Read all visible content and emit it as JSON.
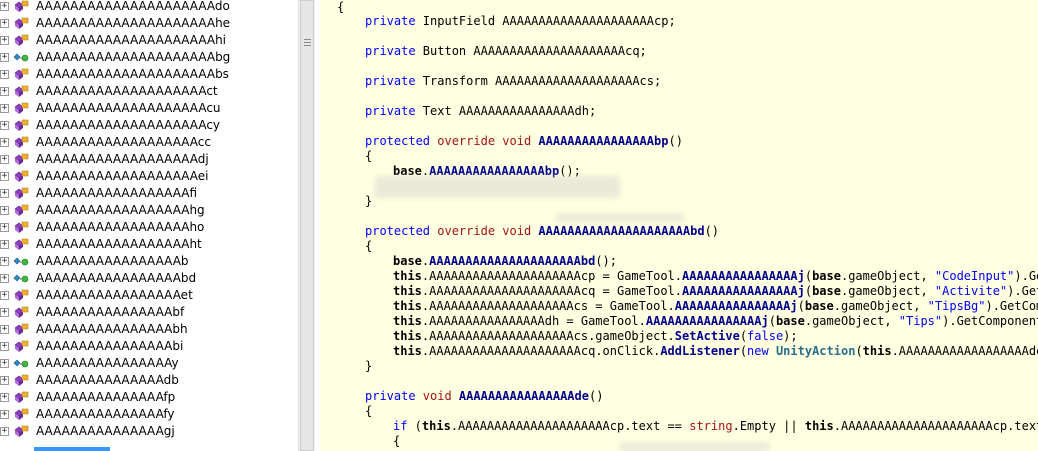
{
  "tree": {
    "items": [
      {
        "label": "AAAAAAAAAAAAAAAAAAAAAdo",
        "icon": "method-icon"
      },
      {
        "label": "AAAAAAAAAAAAAAAAAAAAAhe",
        "icon": "method-icon"
      },
      {
        "label": "AAAAAAAAAAAAAAAAAAAAAhi",
        "icon": "method-icon"
      },
      {
        "label": "AAAAAAAAAAAAAAAAAAAAAbg",
        "icon": "field-icon"
      },
      {
        "label": "AAAAAAAAAAAAAAAAAAAAAbs",
        "icon": "method-icon"
      },
      {
        "label": "AAAAAAAAAAAAAAAAAAAAct",
        "icon": "method-icon"
      },
      {
        "label": "AAAAAAAAAAAAAAAAAAAAcu",
        "icon": "method-icon"
      },
      {
        "label": "AAAAAAAAAAAAAAAAAAAAcy",
        "icon": "method-icon"
      },
      {
        "label": "AAAAAAAAAAAAAAAAAAAcc",
        "icon": "method-icon"
      },
      {
        "label": "AAAAAAAAAAAAAAAAAAAdj",
        "icon": "method-icon"
      },
      {
        "label": "AAAAAAAAAAAAAAAAAAAei",
        "icon": "method-icon"
      },
      {
        "label": "AAAAAAAAAAAAAAAAAAfi",
        "icon": "method-icon"
      },
      {
        "label": "AAAAAAAAAAAAAAAAAAhg",
        "icon": "method-icon"
      },
      {
        "label": "AAAAAAAAAAAAAAAAAAho",
        "icon": "method-icon"
      },
      {
        "label": "AAAAAAAAAAAAAAAAAAht",
        "icon": "method-icon"
      },
      {
        "label": "AAAAAAAAAAAAAAAAAb",
        "icon": "field-icon"
      },
      {
        "label": "AAAAAAAAAAAAAAAAAbd",
        "icon": "field-icon"
      },
      {
        "label": "AAAAAAAAAAAAAAAAAet",
        "icon": "method-icon"
      },
      {
        "label": "AAAAAAAAAAAAAAAAbf",
        "icon": "method-icon"
      },
      {
        "label": "AAAAAAAAAAAAAAAAbh",
        "icon": "method-icon"
      },
      {
        "label": "AAAAAAAAAAAAAAAAbi",
        "icon": "method-icon"
      },
      {
        "label": "AAAAAAAAAAAAAAAAy",
        "icon": "field-icon"
      },
      {
        "label": "AAAAAAAAAAAAAAAdb",
        "icon": "method-icon"
      },
      {
        "label": "AAAAAAAAAAAAAAAfp",
        "icon": "method-icon"
      },
      {
        "label": "AAAAAAAAAAAAAAAfy",
        "icon": "method-icon"
      },
      {
        "label": "AAAAAAAAAAAAAAAgj",
        "icon": "method-icon"
      }
    ],
    "expander_glyph": "+"
  },
  "colors": {
    "code_background": "#ffffe1",
    "keyword": "#0000ff",
    "modifier": "#a31515",
    "method": "#00008b",
    "selection": "#3399ff"
  },
  "code": {
    "l01": "{",
    "l02_kw": "private",
    "l02_rest": " InputField AAAAAAAAAAAAAAAAAAAAAcp;",
    "l03_kw": "private",
    "l03_rest": " Button AAAAAAAAAAAAAAAAAAAAAcq;",
    "l04_kw": "private",
    "l04_rest": " Transform AAAAAAAAAAAAAAAAAAAAcs;",
    "l05_kw": "private",
    "l05_rest": " Text AAAAAAAAAAAAAAAAdh;",
    "l06_kw1": "protected",
    "l06_kw2": " override",
    "l06_kw3": " void",
    "l06_name": " AAAAAAAAAAAAAAAAbp",
    "l06_rest": "()",
    "l07": "{",
    "l08_base": "base",
    "l08_dot": ".",
    "l08_call": "AAAAAAAAAAAAAAAAbp",
    "l08_rest": "();",
    "l09": "}",
    "l10_kw1": "protected",
    "l10_kw2": " override",
    "l10_kw3": " void",
    "l10_name": " AAAAAAAAAAAAAAAAAAAAAbd",
    "l10_rest": "()",
    "l11": "{",
    "l12_base": "base",
    "l12_dot": ".",
    "l12_call": "AAAAAAAAAAAAAAAAAAAAAbd",
    "l12_rest": "();",
    "l13_this": "this",
    "l13_a": ".AAAAAAAAAAAAAAAAAAAAAcp = GameTool.",
    "l13_m": "AAAAAAAAAAAAAAAAj",
    "l13_b": "(",
    "l13_base": "base",
    "l13_c": ".gameObject, ",
    "l13_str": "\"CodeInput\"",
    "l13_d": ").GetCo",
    "l14_this": "this",
    "l14_a": ".AAAAAAAAAAAAAAAAAAAAAcq = GameTool.",
    "l14_m": "AAAAAAAAAAAAAAAAj",
    "l14_b": "(",
    "l14_base": "base",
    "l14_c": ".gameObject, ",
    "l14_str": "\"Activite\"",
    "l14_d": ").GetCom",
    "l15_this": "this",
    "l15_a": ".AAAAAAAAAAAAAAAAAAAAcs = GameTool.",
    "l15_m": "AAAAAAAAAAAAAAAAj",
    "l15_b": "(",
    "l15_base": "base",
    "l15_c": ".gameObject, ",
    "l15_str": "\"TipsBg\"",
    "l15_d": ").GetCompone",
    "l16_this": "this",
    "l16_a": ".AAAAAAAAAAAAAAAAdh = GameTool.",
    "l16_m": "AAAAAAAAAAAAAAAAj",
    "l16_b": "(",
    "l16_base": "base",
    "l16_c": ".gameObject, ",
    "l16_str": "\"Tips\"",
    "l16_d": ").GetComponent<Te",
    "l17_this": "this",
    "l17_a": ".AAAAAAAAAAAAAAAAAAAAcs.gameObject.",
    "l17_m": "SetActive",
    "l17_b": "(",
    "l17_kw": "false",
    "l17_c": ");",
    "l18_this": "this",
    "l18_a": ".AAAAAAAAAAAAAAAAAAAAAcq.onClick.",
    "l18_m": "AddListener",
    "l18_b": "(",
    "l18_kw": "new",
    "l18_t": " UnityAction",
    "l18_c": "(",
    "l18_this2": "this",
    "l18_d": ".AAAAAAAAAAAAAAAAAAde));",
    "l19": "}",
    "l20_kw1": "private",
    "l20_kw2": " void",
    "l20_name": " AAAAAAAAAAAAAAAAde",
    "l20_rest": "()",
    "l21": "{",
    "l22_kw": "if",
    "l22_a": " (",
    "l22_this": "this",
    "l22_b": ".AAAAAAAAAAAAAAAAAAAAAcp.text == ",
    "l22_str": "string",
    "l22_c": ".Empty || ",
    "l22_this2": "this",
    "l22_d": ".AAAAAAAAAAAAAAAAAAAAAcp.text =",
    "l23": "{"
  }
}
